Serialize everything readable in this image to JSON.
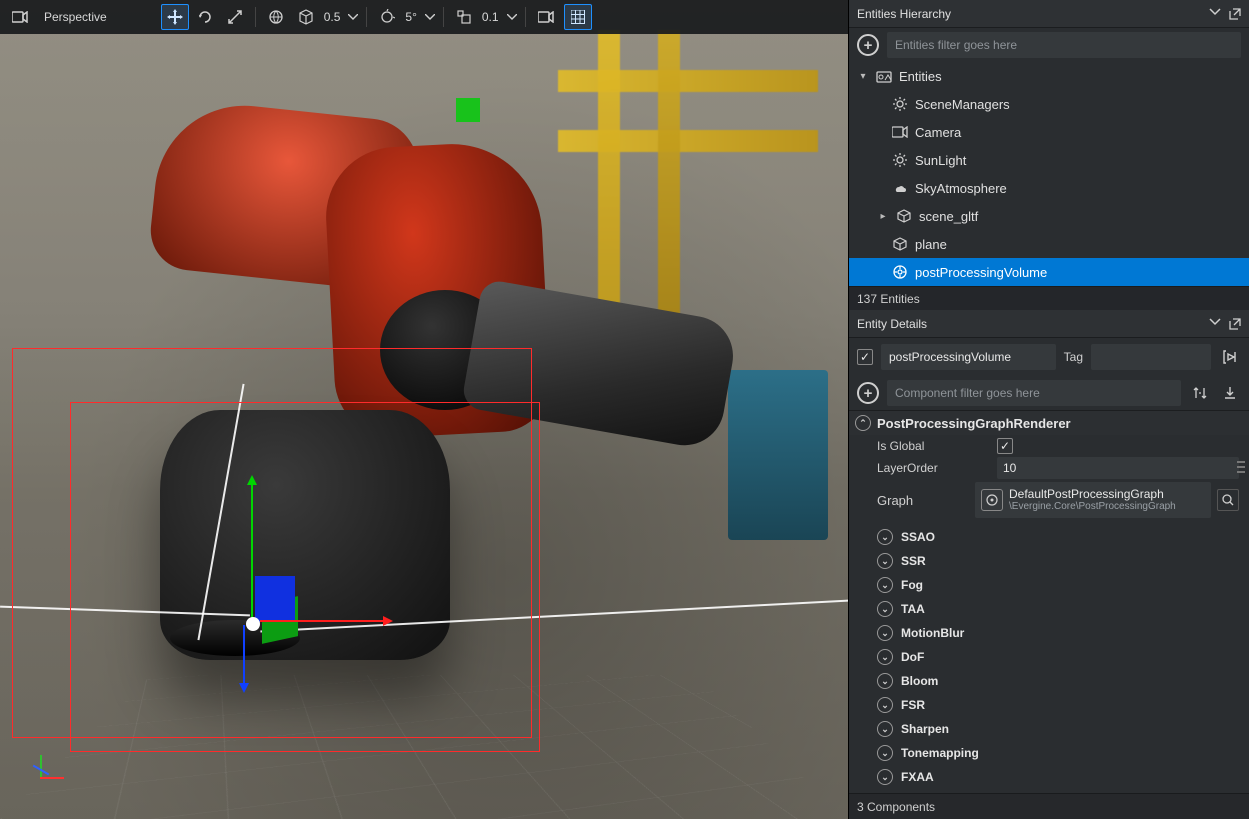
{
  "viewport": {
    "camera_mode": "Perspective",
    "transform_step": "0.5",
    "rotate_step": "5°",
    "scale_step": "0.1"
  },
  "hierarchy": {
    "title": "Entities Hierarchy",
    "filter_placeholder": "Entities filter goes here",
    "root": "Entities",
    "items": [
      {
        "label": "SceneManagers",
        "icon": "gear"
      },
      {
        "label": "Camera",
        "icon": "camera"
      },
      {
        "label": "SunLight",
        "icon": "sun"
      },
      {
        "label": "SkyAtmosphere",
        "icon": "cloud"
      },
      {
        "label": "scene_gltf",
        "icon": "cube",
        "expander": true
      },
      {
        "label": "plane",
        "icon": "cube"
      },
      {
        "label": "postProcessingVolume",
        "icon": "post",
        "selected": true
      }
    ],
    "count": "137 Entities"
  },
  "details": {
    "title": "Entity Details",
    "name": "postProcessingVolume",
    "tag_label": "Tag",
    "tag_value": "",
    "component_filter_placeholder": "Component filter goes here",
    "component_header": "PostProcessingGraphRenderer",
    "props": {
      "is_global_label": "Is Global",
      "is_global": true,
      "layer_order_label": "LayerOrder",
      "layer_order": "10",
      "graph_label": "Graph",
      "graph_name": "DefaultPostProcessingGraph",
      "graph_path": "\\Evergine.Core\\PostProcessingGraph"
    },
    "effects": [
      "SSAO",
      "SSR",
      "Fog",
      "TAA",
      "MotionBlur",
      "DoF",
      "Bloom",
      "FSR",
      "Sharpen",
      "Tonemapping",
      "FXAA"
    ],
    "components_count": "3 Components"
  }
}
